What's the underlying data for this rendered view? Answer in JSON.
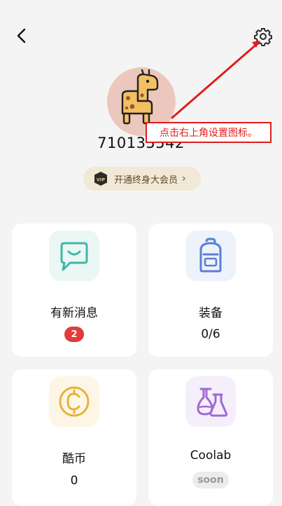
{
  "header": {
    "back_icon": "chevron-left-icon",
    "settings_icon": "gear-icon"
  },
  "profile": {
    "avatar_icon": "giraffe-avatar",
    "username": "710135542",
    "vip_label": "开通终身大会员",
    "vip_badge_text": "VIP"
  },
  "cards": [
    {
      "title": "有新消息",
      "badge": "2",
      "icon": "message-icon",
      "icon_bg": "#eaf7f4",
      "icon_color": "#3fb6a8"
    },
    {
      "title": "装备",
      "value": "0/6",
      "icon": "backpack-icon",
      "icon_bg": "#eef2fb",
      "icon_color": "#5a7fd6"
    },
    {
      "title": "酷币",
      "value": "0",
      "icon": "coin-icon",
      "icon_bg": "#fdf6e6",
      "icon_color": "#e8b23a"
    },
    {
      "title": "Coolab",
      "badge": "soon",
      "icon": "flask-icon",
      "icon_bg": "#f5eefb",
      "icon_color": "#a06ad1"
    }
  ],
  "annotation": {
    "text": "点击右上角设置图标。",
    "color": "#e01d1d"
  }
}
